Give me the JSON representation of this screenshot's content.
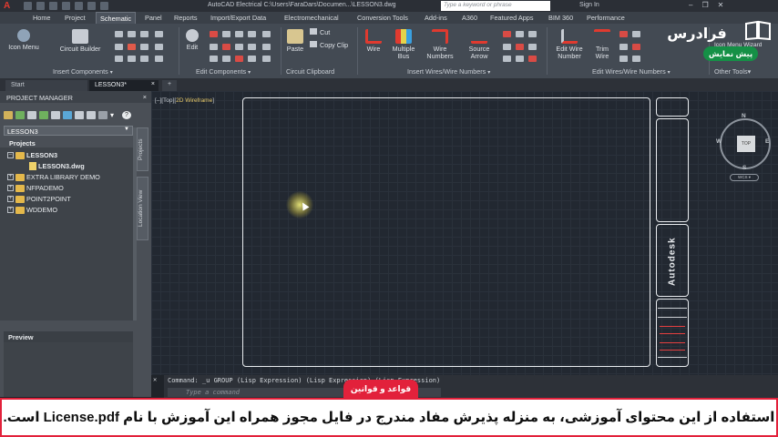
{
  "titlebar": {
    "app_title": "AutoCAD Electrical    C:\\Users\\FaraDars\\Documen...\\LESSON3.dwg",
    "search_placeholder": "Type a keyword or phrase",
    "signin": "Sign In",
    "min": "–",
    "restore": "❐",
    "close": "✕"
  },
  "tabs": [
    "Home",
    "Project",
    "Schematic",
    "Panel",
    "Reports",
    "Import/Export Data",
    "Electromechanical",
    "Conversion Tools",
    "Add-ins",
    "A360",
    "Featured Apps",
    "BIM 360",
    "Performance"
  ],
  "ribbon": {
    "buttons": {
      "icon_menu": "Icon Menu",
      "circuit_builder": "Circuit Builder",
      "edit": "Edit",
      "paste": "Paste",
      "cut": "Cut",
      "copy_clip": "Copy Clip",
      "wire": "Wire",
      "multiple_bus_1": "Multiple",
      "multiple_bus_2": "Bus",
      "wire_numbers_1": "Wire",
      "wire_numbers_2": "Numbers",
      "source_arrow_1": "Source",
      "source_arrow_2": "Arrow",
      "edit_wire_number_1": "Edit Wire",
      "edit_wire_number_2": "Number",
      "trim_wire_1": "Trim",
      "trim_wire_2": "Wire",
      "icon_menu_wizard": "Icon Menu Wizard"
    },
    "groups": {
      "insert_components": "Insert Components",
      "edit_components": "Edit Components",
      "circuit_clipboard": "Circuit Clipboard",
      "insert_wires": "Insert Wires/Wire Numbers",
      "edit_wires": "Edit Wires/Wire Numbers",
      "other_tools": "Other Tools"
    },
    "chevron": "▾"
  },
  "doc_tabs": {
    "start": "Start",
    "lesson3": "LESSON3*",
    "close": "×",
    "add": "+"
  },
  "project_manager": {
    "title": "PROJECT MANAGER",
    "close": "×",
    "combo_value": "LESSON3",
    "projects_label": "Projects",
    "tree": [
      {
        "label": "LESSON3",
        "bold": true
      },
      {
        "label": "LESSON3.dwg",
        "bold": true
      },
      {
        "label": "EXTRA LIBRARY DEMO",
        "bold": false
      },
      {
        "label": "NFPADEMO",
        "bold": false
      },
      {
        "label": "POINT2POINT",
        "bold": false
      },
      {
        "label": "WDDEMO",
        "bold": false
      }
    ],
    "vtab_projects": "Projects",
    "vtab_location": "Location View",
    "preview_label": "Preview"
  },
  "viewport": {
    "controls_prefix": "[–][Top][",
    "visual_style": "2D Wireframe",
    "controls_suffix": "]",
    "cube_top": "TOP",
    "north": "N",
    "south": "S",
    "east": "E",
    "west": "W",
    "wcs": "WCS ▾",
    "brand_text": "Autodesk"
  },
  "command": {
    "history": "Command: _u GROUP (Lisp Expression) (Lisp Expression) (Lisp Expression)",
    "placeholder": "Type a command",
    "x_icon": "✕"
  },
  "overlay": {
    "rules_tab": "قواعد و قوانین",
    "notice": "استفاده از این محتوای آموزشی، به منزله پذیرش مفاد مندرج در فایل مجوز همراه این آموزش با نام License.pdf است."
  },
  "watermark": {
    "name": "فرادرس",
    "pill": "پیش نمایش"
  },
  "colors": {
    "accent_red": "#e2213b",
    "watermark_green": "#159046",
    "autocad_red": "#e03a2f"
  }
}
